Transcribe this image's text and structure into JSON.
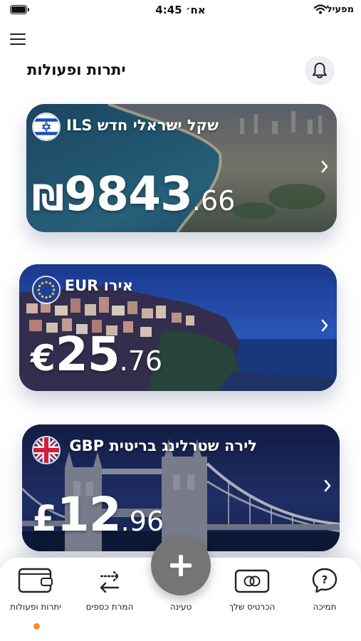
{
  "status_bar": {
    "time": "4:45 אח׳",
    "carrier": "מפעיל"
  },
  "header": {
    "title": "יתרות ופעולות"
  },
  "cards": [
    {
      "code": "ILS",
      "name": "שקל ישראלי חדש ILS",
      "symbol": "₪",
      "integer": "9843",
      "decimal": ".66",
      "flag": "israel-flag-icon",
      "scene": "tel-aviv-coast"
    },
    {
      "code": "EUR",
      "name": "אירו EUR",
      "symbol": "€",
      "integer": "25",
      "decimal": ".76",
      "flag": "eu-flag-icon",
      "scene": "cinque-terre-night"
    },
    {
      "code": "GBP",
      "name": "לירה שטרלינג בריטית GBP",
      "symbol": "£",
      "integer": "12",
      "decimal": ".96",
      "flag": "uk-flag-icon",
      "scene": "tower-bridge-night"
    }
  ],
  "bottom_nav": {
    "items": [
      {
        "label": "יתרות ופעולות",
        "icon": "wallet-icon",
        "active": true
      },
      {
        "label": "המרת כספים",
        "icon": "exchange-arrows-icon"
      },
      {
        "label": "טעינה",
        "icon": "plus-icon"
      },
      {
        "label": "הכרטיס שלך",
        "icon": "card-icon"
      },
      {
        "label": "תמיכה",
        "icon": "help-bubble-icon"
      }
    ]
  },
  "colors": {
    "accent_dot": "#f0902a",
    "fab": "#757575",
    "bell_bg": "#eceef1"
  }
}
